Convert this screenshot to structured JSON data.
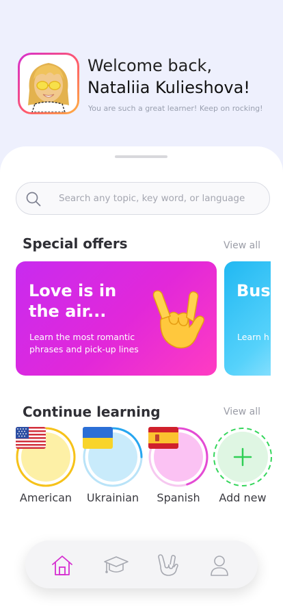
{
  "header": {
    "welcome": "Welcome back,",
    "name": "Nataliia Kulieshova!",
    "subtitle": "You are such a great learner! Keep on rocking!"
  },
  "search": {
    "placeholder": "Search any topic, key word, or language",
    "icon": "search-icon"
  },
  "special_offers": {
    "title": "Special offers",
    "view_all": "View all",
    "offers": [
      {
        "title": "Love is in the air...",
        "description": "Learn the most romantic phrases and pick-up lines",
        "icon": "rock-hand-emoji",
        "color": "#e228d9"
      },
      {
        "title": "Busi slan",
        "description": "Learn h true bus",
        "color": "#21b8f2"
      }
    ]
  },
  "continue_learning": {
    "title": "Continue learning",
    "view_all": "View all",
    "languages": [
      {
        "label": "American",
        "flag": "us-flag-icon",
        "ring_color": "#f6c21a",
        "progress": 0.98,
        "bg": "#fdf0a6"
      },
      {
        "label": "Ukrainian",
        "flag": "ua-flag-icon",
        "ring_color": "#27a6f0",
        "progress": 0.25,
        "bg": "#c9ebfb"
      },
      {
        "label": "Spanish",
        "flag": "es-flag-icon",
        "ring_color": "#e44bd4",
        "progress": 0.45,
        "bg": "#fbc2f3"
      },
      {
        "label": "Add new",
        "icon": "plus-icon",
        "ring_color": "#34d65b",
        "bg": "#dff6e3"
      }
    ]
  },
  "nav": {
    "items": [
      {
        "icon": "home-icon",
        "active": true
      },
      {
        "icon": "graduation-cap-icon",
        "active": false
      },
      {
        "icon": "rock-hand-icon",
        "active": false
      },
      {
        "icon": "profile-icon",
        "active": false
      }
    ],
    "active_color": "#d52dd0",
    "inactive_color": "#a6a8b0"
  }
}
